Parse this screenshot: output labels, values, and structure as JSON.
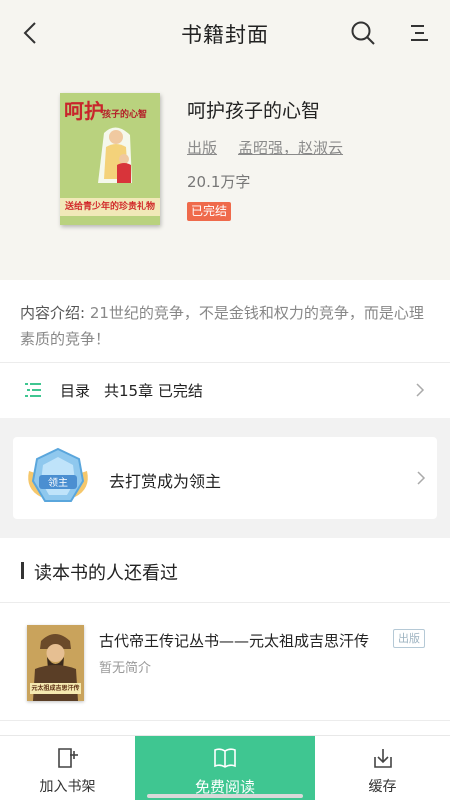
{
  "colors": {
    "accent": "#3fc691",
    "header_bg": "#f6f5f0",
    "badge": "#ef6a4b"
  },
  "header": {
    "title": "书籍封面",
    "back_icon": "back-arrow-icon",
    "search_icon": "search-icon",
    "menu_icon": "menu-icon"
  },
  "book": {
    "title": "呵护孩子的心智",
    "type": "出版",
    "author": "孟昭强，赵淑云",
    "word_count": "20.1万字",
    "status": "已完结",
    "cover": {
      "big_title": "呵护",
      "small_title": "孩子的心智",
      "band": "送给青少年的珍贵礼物"
    }
  },
  "intro": {
    "label": "内容介绍:",
    "text": " 21世纪的竞争，不是金钱和权力的竞争，而是心理素质的竞争！"
  },
  "toc": {
    "label": "目录",
    "summary": "共15章 已完结"
  },
  "reward": {
    "text": "去打赏成为领主",
    "medal_text": "领主"
  },
  "also_read": {
    "section_title": "读本书的人还看过",
    "items": [
      {
        "title": "古代帝王传记丛书——元太祖成吉思汗传",
        "tag": "出版",
        "desc": "暂无简介",
        "cover_caption": "元太祖成吉思汗传"
      }
    ]
  },
  "bottom_nav": {
    "add_shelf": "加入书架",
    "free_read": "免费阅读",
    "cache": "缓存"
  }
}
